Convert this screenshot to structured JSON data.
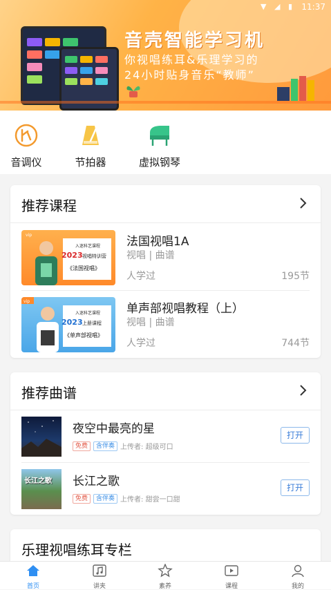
{
  "status": {
    "time": "11:37"
  },
  "banner": {
    "title": "音壳智能学习机",
    "subtitle_line1": "你视唱练耳&乐理学习的",
    "subtitle_line2": "24小时贴身音乐“教师”"
  },
  "tools": [
    {
      "label": "音调仪",
      "icon": "tuner-icon"
    },
    {
      "label": "节拍器",
      "icon": "metronome-icon"
    },
    {
      "label": "虚拟钢琴",
      "icon": "piano-icon"
    }
  ],
  "courses": {
    "title": "推荐课程",
    "items": [
      {
        "name": "法国视唱1A",
        "tags": "视唱 | 曲谱",
        "learners": "人学过",
        "count": "195节",
        "thumb_line1": "2023",
        "thumb_line2": "视唱特训营",
        "thumb_line3": "《法国视唱》",
        "thumb_header": "入迷科艺课程"
      },
      {
        "name": "单声部视唱教程（上）",
        "tags": "视唱 | 曲谱",
        "learners": "人学过",
        "count": "744节",
        "thumb_line1": "2023",
        "thumb_line2": "上册课程",
        "thumb_line3": "《单声部视唱》",
        "thumb_header": "入迷科艺课程"
      }
    ]
  },
  "scores": {
    "title": "推荐曲谱",
    "items": [
      {
        "name": "夜空中最亮的星",
        "badge_free": "免费",
        "badge_acc": "含伴奏",
        "uploader": "上传者: 超级可口",
        "open": "打开"
      },
      {
        "name": "长江之歌",
        "badge_free": "免费",
        "badge_acc": "含伴奏",
        "uploader": "上传者: 甜尝一口甜",
        "open": "打开",
        "thumb_text": "长江之歌"
      }
    ]
  },
  "column": {
    "title": "乐理视唱练耳专栏"
  },
  "tabbar": [
    {
      "label": "首页",
      "active": true
    },
    {
      "label": "讲夹",
      "active": false
    },
    {
      "label": "素养",
      "active": false
    },
    {
      "label": "课程",
      "active": false
    },
    {
      "label": "我的",
      "active": false
    }
  ],
  "colors": {
    "accent": "#2f8ff2",
    "orange": "#ff9a3c"
  }
}
